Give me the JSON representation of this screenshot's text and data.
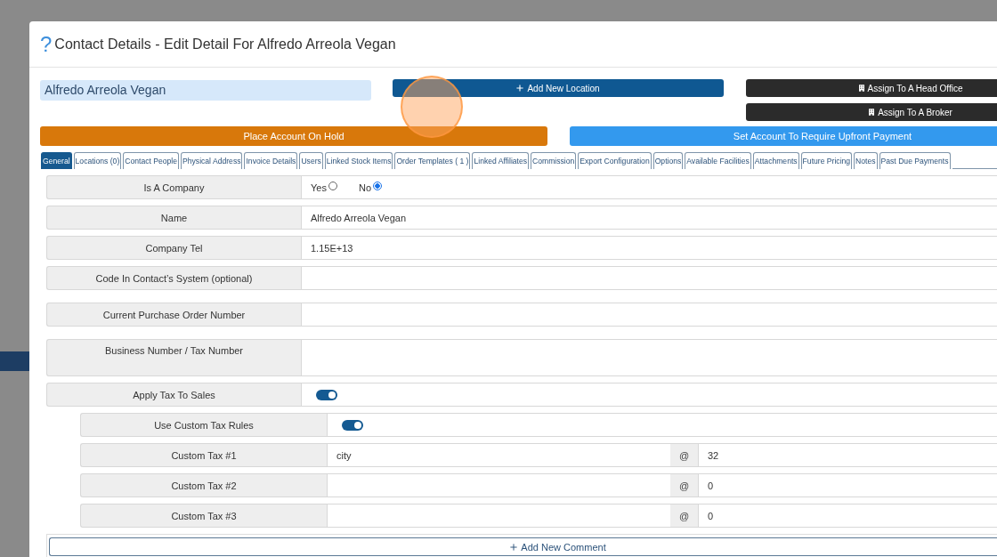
{
  "window": {
    "help_icon": "?",
    "title": "Contact Details - Edit Detail For Alfredo Arreola Vegan"
  },
  "header": {
    "name_field": {
      "value": "Alfredo Arreola Vegan"
    },
    "add_location_button": {
      "label": "Add New Location"
    },
    "assign_buttons": [
      {
        "label": "Assign To A Head Office"
      },
      {
        "label": "Assign To A Broker"
      }
    ]
  },
  "account_buttons": [
    {
      "label": "Place Account On Hold",
      "kind": "warning"
    },
    {
      "label": "Set Account To Require Upfront Payment",
      "kind": "info"
    }
  ],
  "tabs": [
    {
      "label": "General",
      "selected": true
    },
    {
      "label": "Locations (0)",
      "selected": false
    },
    {
      "label": "Contact People",
      "selected": false
    },
    {
      "label": "Physical Address",
      "selected": false
    },
    {
      "label": "Invoice Details",
      "selected": false
    },
    {
      "label": "Users",
      "selected": false
    },
    {
      "label": "Linked Stock Items",
      "selected": false
    },
    {
      "label": "Order Templates ( 1 )",
      "selected": false
    },
    {
      "label": "Linked Affiliates",
      "selected": false
    },
    {
      "label": "Commission",
      "selected": false
    },
    {
      "label": "Export Configuration",
      "selected": false
    },
    {
      "label": "Options",
      "selected": false
    },
    {
      "label": "Available Facilities",
      "selected": false
    },
    {
      "label": "Attachments",
      "selected": false
    },
    {
      "label": "Future Pricing",
      "selected": false
    },
    {
      "label": "Notes",
      "selected": false
    },
    {
      "label": "Past Due Payments",
      "selected": false
    }
  ],
  "form": {
    "rows": [
      {
        "label": "Is A Company",
        "kind": "radio",
        "options": [
          {
            "label": "Yes",
            "selected": false
          },
          {
            "label": "No",
            "selected": true
          }
        ]
      },
      {
        "label": "Name",
        "kind": "text",
        "value": "Alfredo Arreola Vegan"
      },
      {
        "label": "Company Tel",
        "kind": "text",
        "value": "1.15E+13"
      },
      {
        "label": "Code In Contact’s System (optional)",
        "kind": "text"
      },
      {
        "label": "Current Purchase Order Number",
        "kind": "text"
      },
      {
        "label": "Business Number / Tax Number",
        "kind": "textarea"
      },
      {
        "label": "Apply Tax To Sales",
        "kind": "toggle",
        "on": true,
        "children": [
          {
            "label": "Use Custom Tax Rules",
            "kind": "toggle",
            "on": true
          },
          {
            "label": "Custom Tax #1",
            "kind": "tax",
            "name": "city",
            "addon": "@",
            "rate": "32"
          },
          {
            "label": "Custom Tax #2",
            "kind": "tax",
            "addon": "@",
            "rate": "0"
          },
          {
            "label": "Custom Tax #3",
            "kind": "tax",
            "addon": "@",
            "rate": "0"
          }
        ]
      }
    ]
  },
  "comments": {
    "add_button": {
      "label": "Add New Comment"
    }
  }
}
